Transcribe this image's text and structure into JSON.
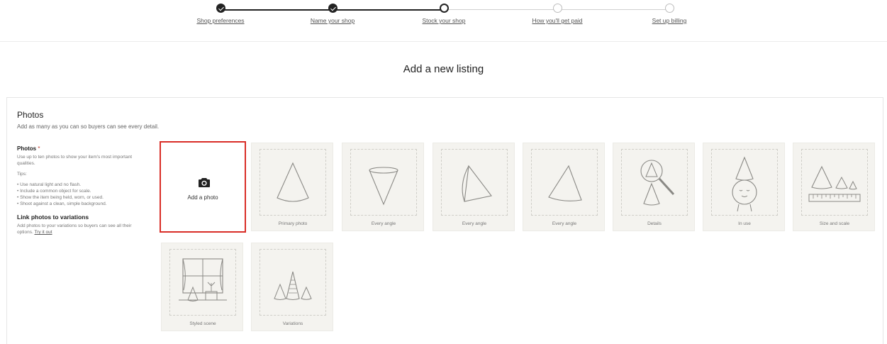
{
  "stepper": {
    "steps": [
      {
        "label": "Shop preferences",
        "state": "done"
      },
      {
        "label": "Name your shop",
        "state": "done"
      },
      {
        "label": "Stock your shop",
        "state": "current"
      },
      {
        "label": "How you'll get paid",
        "state": "todo"
      },
      {
        "label": "Set up billing",
        "state": "todo"
      }
    ]
  },
  "page": {
    "title": "Add a new listing"
  },
  "photos": {
    "title": "Photos",
    "subtitle": "Add as many as you can so buyers can see every detail.",
    "sidebar": {
      "heading": "Photos",
      "required_mark": "*",
      "intro": "Use up to ten photos to show your item's most important qualities.",
      "tips_label": "Tips:",
      "tips": [
        "Use natural light and no flash.",
        "Include a common object for scale.",
        "Show the item being held, worn, or used.",
        "Shoot against a clean, simple background."
      ],
      "variations_heading": "Link photos to variations",
      "variations_text": "Add photos to your variations so buyers can see all their options.",
      "variations_link": "Try it out"
    },
    "add_button": {
      "label": "Add a photo",
      "icon": "camera-icon"
    },
    "tiles": [
      {
        "label": "Primary photo",
        "icon": "cone-icon"
      },
      {
        "label": "Every angle",
        "icon": "cone-inverted-icon"
      },
      {
        "label": "Every angle",
        "icon": "cone-tilted-icon"
      },
      {
        "label": "Every angle",
        "icon": "cone-side-icon"
      },
      {
        "label": "Details",
        "icon": "magnifier-icon"
      },
      {
        "label": "In use",
        "icon": "character-icon"
      },
      {
        "label": "Size and scale",
        "icon": "ruler-icon"
      },
      {
        "label": "Styled scene",
        "icon": "window-scene-icon"
      },
      {
        "label": "Variations",
        "icon": "cones-group-icon"
      }
    ]
  }
}
